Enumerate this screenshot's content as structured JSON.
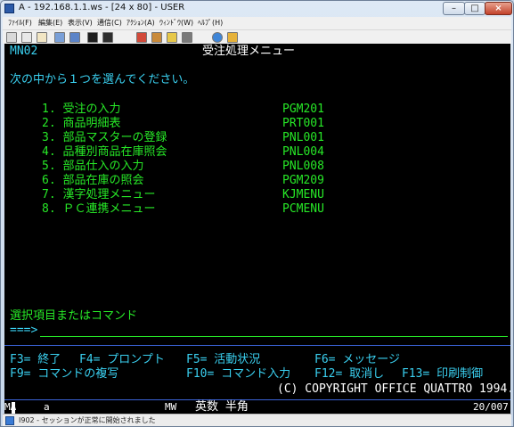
{
  "window": {
    "title": "A - 192.168.1.1.ws - [24 x 80] - USER",
    "min": "–",
    "max": "□",
    "close": "×"
  },
  "menu": [
    "ﾌｧｲﾙ(F)",
    "編集(E)",
    "表示(V)",
    "通信(C)",
    "ｱｸｼｮﾝ(A)",
    "ｳｨﾝﾄﾞｳ(W)",
    "ﾍﾙﾌﾟ(H)"
  ],
  "toolbar": [
    "print-icon",
    "copy-icon",
    "paste-icon",
    "send-icon",
    "receive-icon",
    "display-icon",
    "macro-record-icon",
    "macro-play-icon",
    "keypad-icon",
    "customize-icon",
    "map-icon",
    "globe-icon",
    "help-icon"
  ],
  "screen": {
    "screen_id": "MN02",
    "title": "受注処理メニュー",
    "instruction": "次の中から１つを選んでください。",
    "items": [
      {
        "label": "1. 受注の入力",
        "program": "PGM201"
      },
      {
        "label": "2. 商品明細表",
        "program": "PRT001"
      },
      {
        "label": "3. 部品マスターの登録",
        "program": "PNL001"
      },
      {
        "label": "4. 品種別商品在庫照会",
        "program": "PNL004"
      },
      {
        "label": "5. 部品仕入の入力",
        "program": "PNL008"
      },
      {
        "label": "6. 部品在庫の照会",
        "program": "PGM209"
      },
      {
        "label": "7. 漢字処理メニュー",
        "program": "KJMENU"
      },
      {
        "label": "8. ＰＣ連携メニュー",
        "program": "PCMENU"
      }
    ],
    "prompt": "選択項目またはコマンド",
    "arrow": "===>",
    "fkeys": {
      "f3": "F3= 終了",
      "f4": "F4= プロンプト",
      "f5": "F5= 活動状況",
      "f6": "F6= メッセージ",
      "f9": "F9= コマンドの複写",
      "f10": "F10= コマンド入力",
      "f12": "F12= 取消し",
      "f13": "F13= 印刷制御"
    },
    "copyright": "(C) COPYRIGHT OFFICE QUATTRO 1994."
  },
  "oia": {
    "ma": "MA",
    "a": "a",
    "mw": "MW",
    "mode": "英数 半角",
    "cursor": "20/007"
  },
  "status": {
    "message": "I902 - セッションが正常に開始されました"
  },
  "colors": {
    "green": "#27e827",
    "cyan": "#3ad0f0",
    "white": "#ffffff",
    "blue_line": "#3a62d6"
  }
}
